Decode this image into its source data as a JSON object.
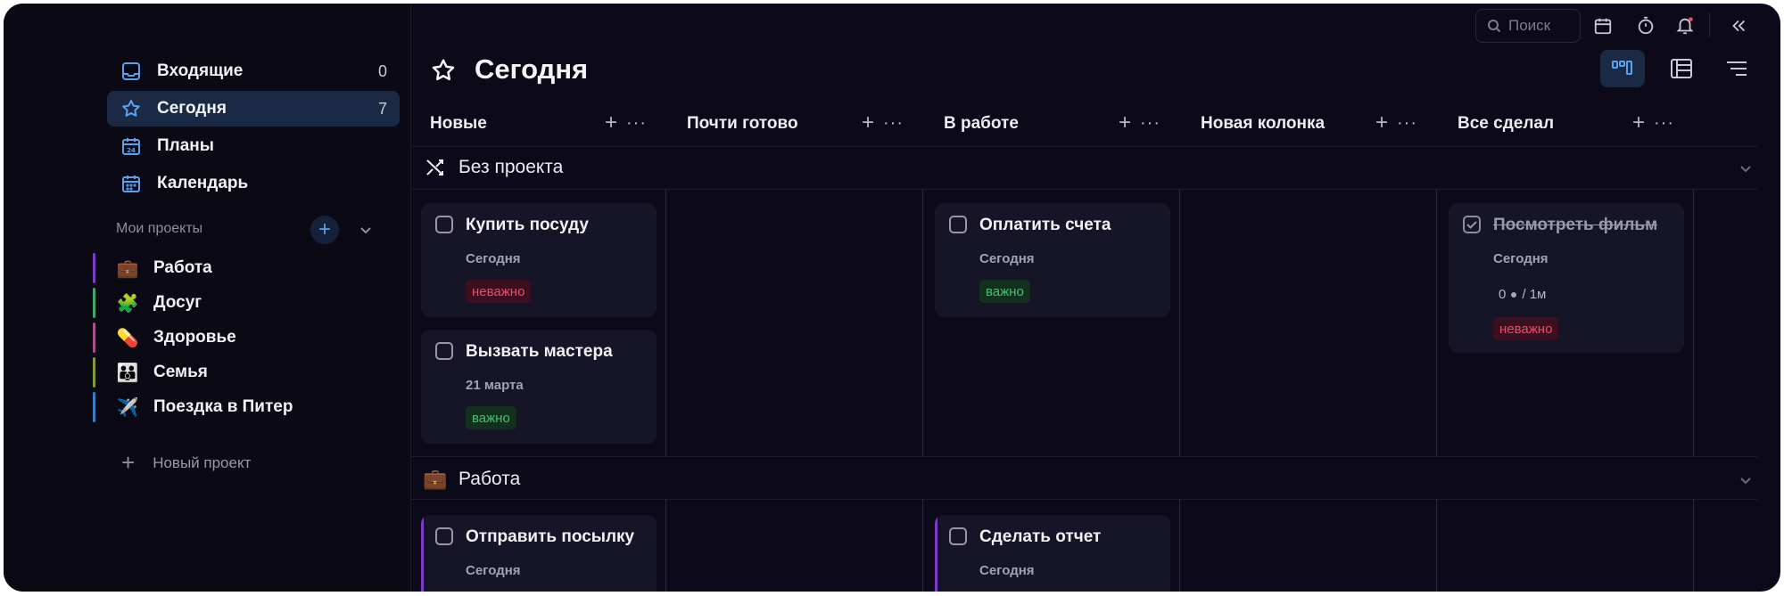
{
  "colors": {
    "accent": "#5aa2f0",
    "red": "#ef4a6a",
    "green": "#45c06a",
    "background": "#0c0a18"
  },
  "sidebar": {
    "nav": [
      {
        "label": "Входящие",
        "count": "0",
        "icon": "inbox-icon"
      },
      {
        "label": "Сегодня",
        "count": "7",
        "icon": "star-icon"
      },
      {
        "label": "Планы",
        "icon": "calendar-24-icon"
      },
      {
        "label": "Календарь",
        "icon": "calendar-grid-icon"
      }
    ],
    "projects_label": "Мои проекты",
    "projects": [
      {
        "emoji": "💼",
        "label": "Работа",
        "color": "#7a3cc9"
      },
      {
        "emoji": "🧩",
        "label": "Досуг",
        "color": "#3fa66a"
      },
      {
        "emoji": "💊",
        "label": "Здоровье",
        "color": "#a84e8a"
      },
      {
        "emoji": "👪",
        "label": "Семья",
        "color": "#7f9a3a"
      },
      {
        "emoji": "✈️",
        "label": "Поездка в Питер",
        "color": "#3a7fc2"
      }
    ],
    "new_project": "Новый проект"
  },
  "toolbar": {
    "search_placeholder": "Поиск"
  },
  "header": {
    "title": "Сегодня"
  },
  "columns": [
    "Новые",
    "Почти готово",
    "В работе",
    "Новая колонка",
    "Все сделал"
  ],
  "groups": [
    {
      "name": "Без проекта",
      "cards": [
        {
          "column": 0,
          "title": "Купить посуду",
          "date": "Сегодня",
          "badge": "неважно",
          "badge_color": "red"
        },
        {
          "column": 0,
          "title": "Вызвать мастера",
          "date": "21 марта",
          "badge": "важно",
          "badge_color": "green"
        },
        {
          "column": 2,
          "title": "Оплатить счета",
          "date": "Сегодня",
          "badge": "важно",
          "badge_color": "green"
        },
        {
          "column": 4,
          "title": "Посмотреть фильм",
          "date": "Сегодня",
          "done": true,
          "timer_count": "0",
          "timer_duration": "1м",
          "badge": "неважно",
          "badge_color": "red"
        }
      ]
    },
    {
      "name": "Работа",
      "emoji": "💼",
      "cards": [
        {
          "column": 0,
          "title": "Отправить посылку",
          "date": "Сегодня"
        },
        {
          "column": 2,
          "title": "Сделать отчет",
          "date": "Сегодня"
        }
      ]
    }
  ]
}
